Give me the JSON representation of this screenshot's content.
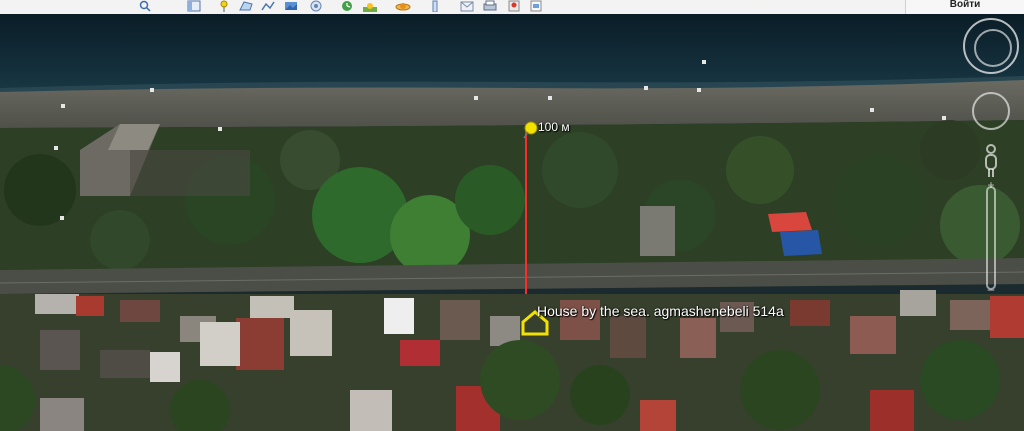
{
  "toolbar": {
    "signin_label": "Войти",
    "buttons": [
      {
        "icon": "search-icon"
      },
      {
        "icon": "sidebar-icon"
      },
      {
        "icon": "placemark-icon"
      },
      {
        "icon": "polygon-icon"
      },
      {
        "icon": "path-icon"
      },
      {
        "icon": "image-overlay-icon"
      },
      {
        "icon": "record-tour-icon"
      },
      {
        "icon": "historical-imagery-icon"
      },
      {
        "icon": "sunlight-icon"
      },
      {
        "icon": "planets-icon"
      },
      {
        "icon": "ruler-icon"
      },
      {
        "icon": "email-icon"
      },
      {
        "icon": "print-icon"
      },
      {
        "icon": "google-maps-icon"
      },
      {
        "icon": "kml-icon"
      }
    ]
  },
  "map": {
    "placemark_label": "House by the sea. agmashenebeli 514a",
    "measure_label": "100 м",
    "colors": {
      "sea": "#0f2530",
      "beach": "#5d5e56",
      "trees": "#2f4628",
      "road": "#4d504a",
      "measure_line": "#ff2a2a",
      "placemark": "#f2e200"
    }
  },
  "nav": {
    "zoom_plus": "+",
    "zoom_minus": "–"
  }
}
